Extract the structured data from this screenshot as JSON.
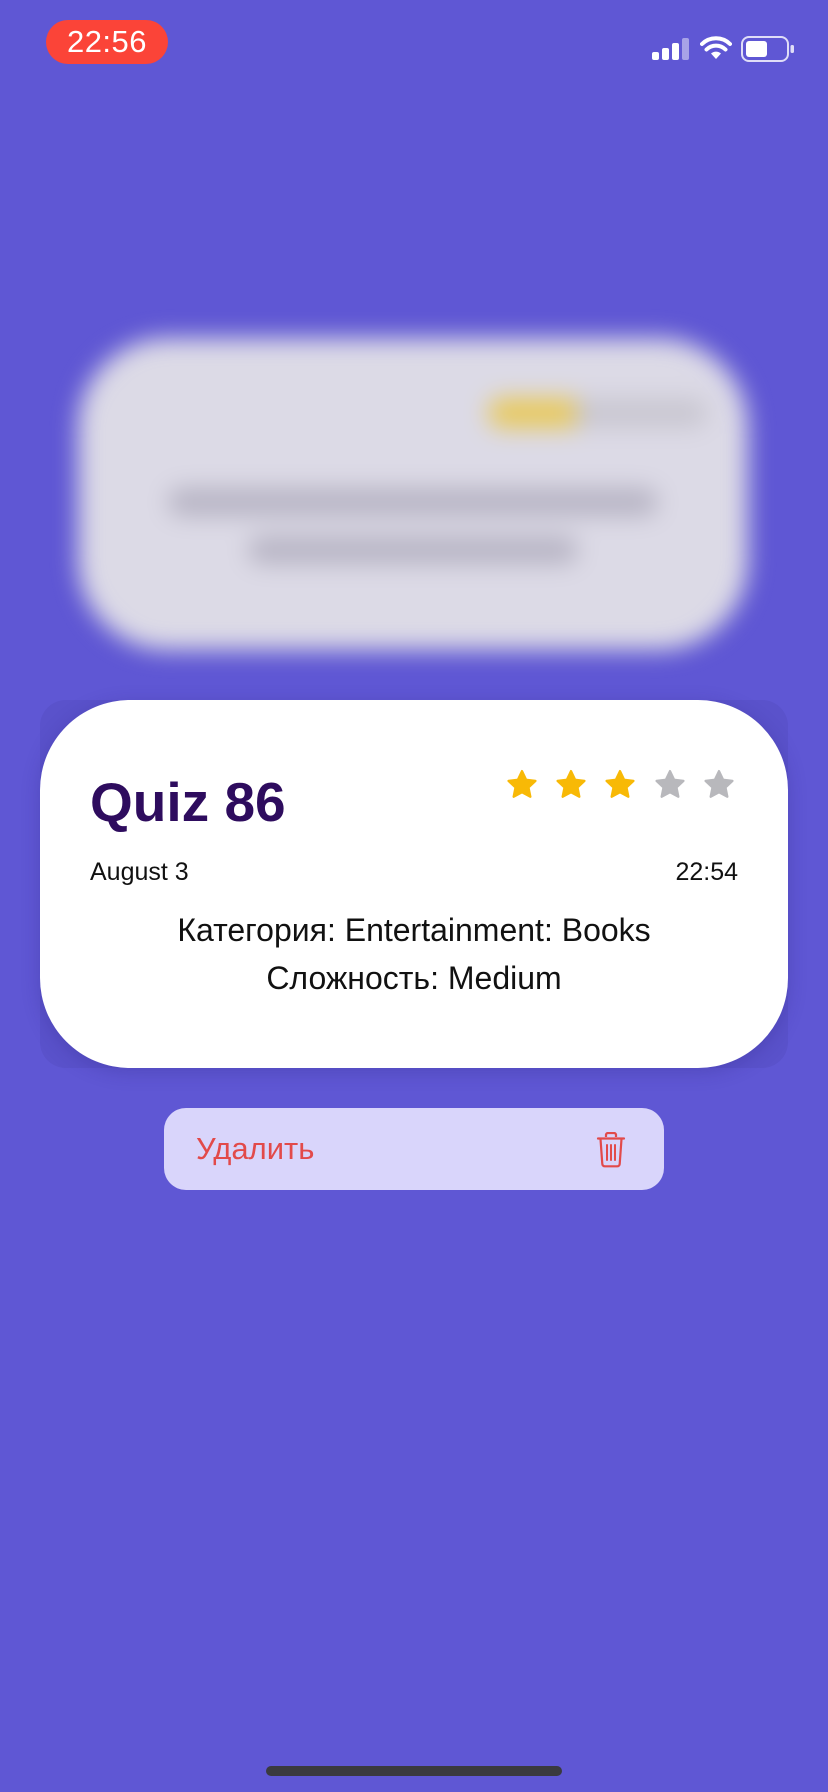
{
  "status_bar": {
    "time": "22:56",
    "signal_icon": "cellular-signal-icon",
    "wifi_icon": "wifi-icon",
    "battery_icon": "battery-icon"
  },
  "background": {
    "blurred": true
  },
  "quiz_card": {
    "title": "Quiz 86",
    "rating": 3,
    "rating_max": 5,
    "date": "August 3",
    "time": "22:54",
    "category": "Категория: Entertainment: Books",
    "difficulty": "Сложность: Medium"
  },
  "context_menu": {
    "delete_label": "Удалить",
    "delete_icon": "trash-icon"
  },
  "colors": {
    "background": "#5f57d4",
    "title": "#2e0c5e",
    "star_filled": "#f8b906",
    "star_empty": "#b8b8bc",
    "destructive": "#e24a4a",
    "time_pill": "#fb4438",
    "menu_background": "#d9d5fb"
  }
}
